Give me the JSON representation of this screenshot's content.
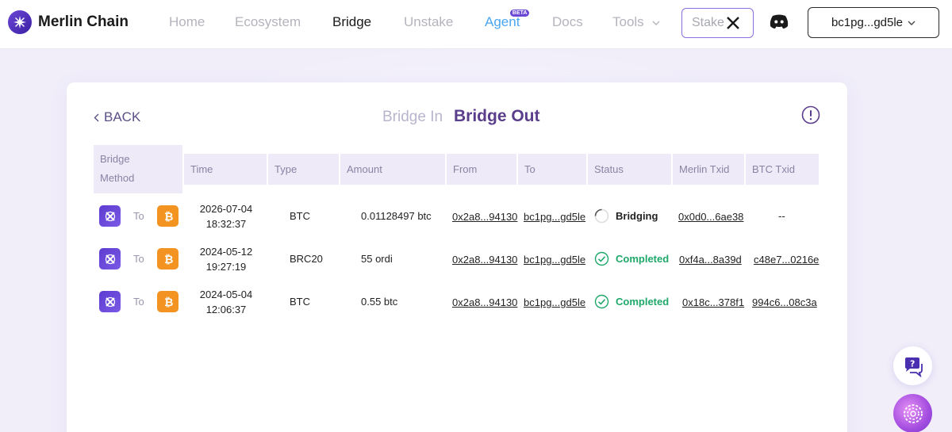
{
  "header": {
    "logo_text": "Merlin Chain",
    "nav": {
      "home": "Home",
      "ecosystem": "Ecosystem",
      "bridge": "Bridge",
      "unstake": "Unstake",
      "agent": "Agent",
      "agent_badge": "BETA",
      "docs": "Docs",
      "tools": "Tools"
    },
    "stake_label": "Stake",
    "wallet_address": "bc1pg...gd5le"
  },
  "bridge": {
    "back_label": "BACK",
    "tab_in": "Bridge In",
    "tab_out": "Bridge Out",
    "columns": {
      "method": "Bridge Method",
      "time": "Time",
      "type": "Type",
      "amount": "Amount",
      "from": "From",
      "to": "To",
      "status": "Status",
      "merlin_txid": "Merlin Txid",
      "btc_txid": "BTC Txid"
    },
    "to_word": "To",
    "rows": [
      {
        "date": "2026-07-04",
        "time": "18:32:37",
        "type": "BTC",
        "amount": "0.01128497 btc",
        "from": "0x2a8...94130",
        "to": "bc1pg...gd5le",
        "status": "Bridging",
        "merlin_txid": "0x0d0...6ae38",
        "btc_txid": "--"
      },
      {
        "date": "2024-05-12",
        "time": "19:27:19",
        "type": "BRC20",
        "amount": "55 ordi",
        "from": "0x2a8...94130",
        "to": "bc1pg...gd5le",
        "status": "Completed",
        "merlin_txid": "0xf4a...8a39d",
        "btc_txid": "c48e7...0216e"
      },
      {
        "date": "2024-05-04",
        "time": "12:06:37",
        "type": "BTC",
        "amount": "0.55 btc",
        "from": "0x2a8...94130",
        "to": "bc1pg...gd5le",
        "status": "Completed",
        "merlin_txid": "0x18c...378f1",
        "btc_txid": "994c6...08c3a"
      }
    ]
  },
  "colors": {
    "brand": "#6b47d6",
    "completed": "#1fa86a",
    "btc": "#f39321"
  },
  "icons": [
    "merlin-logo-icon",
    "x-icon",
    "discord-icon",
    "chevron-down-icon",
    "info-icon",
    "bitcoin-icon",
    "spinner-icon",
    "check-circle-icon",
    "help-chat-icon",
    "ai-assistant-icon"
  ]
}
